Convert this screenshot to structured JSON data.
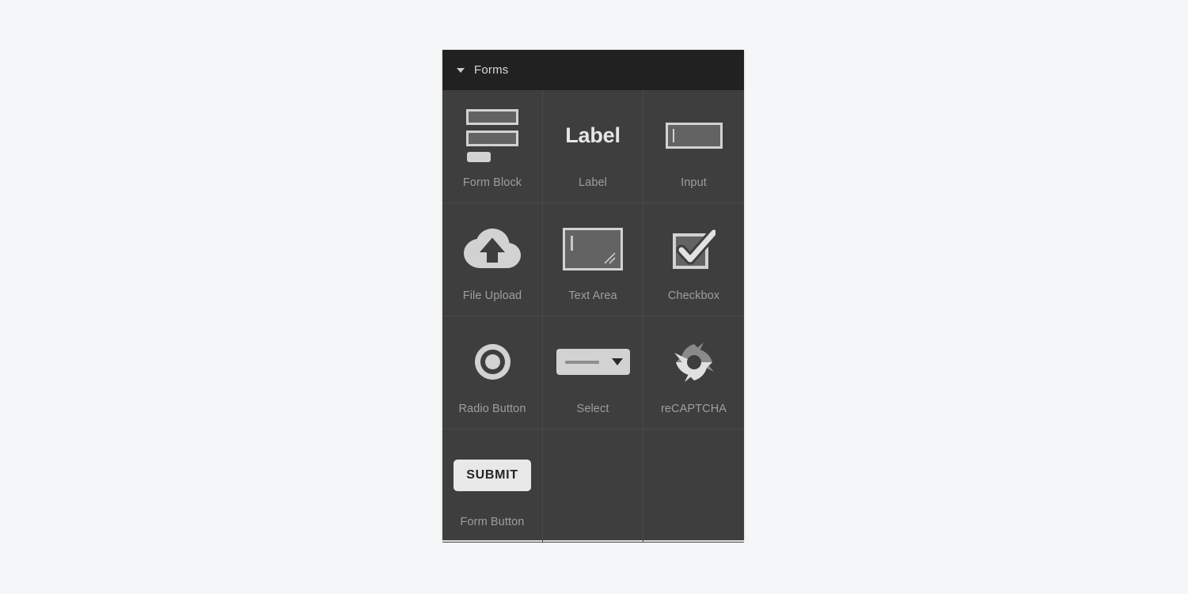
{
  "panel": {
    "title": "Forms",
    "disclosure_icon": "chevron-down-icon",
    "header_bg": "#212121",
    "body_bg": "#3e3e3e",
    "label_color": "#9e9e9e",
    "items": [
      {
        "label": "Form Block",
        "icon": "form-block-icon"
      },
      {
        "label": "Label",
        "icon": "label-icon",
        "glyph": "Label"
      },
      {
        "label": "Input",
        "icon": "input-field-icon"
      },
      {
        "label": "File Upload",
        "icon": "cloud-upload-icon"
      },
      {
        "label": "Text Area",
        "icon": "text-area-icon"
      },
      {
        "label": "Checkbox",
        "icon": "checkbox-icon"
      },
      {
        "label": "Radio Button",
        "icon": "radio-button-icon"
      },
      {
        "label": "Select",
        "icon": "select-dropdown-icon"
      },
      {
        "label": "reCAPTCHA",
        "icon": "recaptcha-refresh-icon"
      },
      {
        "label": "Form Button",
        "icon": "submit-button-icon",
        "button_text": "SUBMIT"
      }
    ]
  }
}
